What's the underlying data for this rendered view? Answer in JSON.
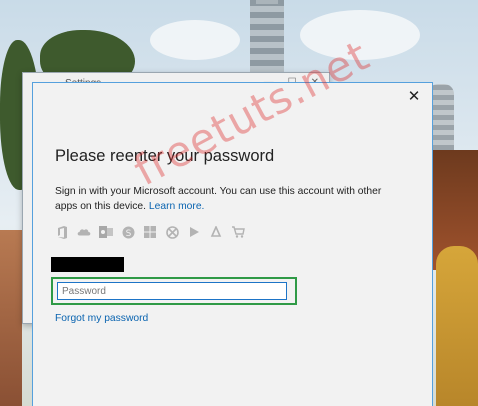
{
  "back_window": {
    "title": "Settings",
    "back_symbol": "←",
    "controls": [
      "—",
      "☐",
      "✕"
    ]
  },
  "dialog": {
    "close_symbol": "✕",
    "title": "Please reenter your password",
    "description": "Sign in with your Microsoft account. You can use this account with other apps on this device.",
    "learn_more": "Learn more.",
    "app_icons": [
      "office-icon",
      "onedrive-icon",
      "outlook-icon",
      "skype-icon",
      "windows-icon",
      "xbox-icon",
      "video-icon",
      "music-icon",
      "store-icon"
    ],
    "password": {
      "placeholder": "Password",
      "value": ""
    },
    "forgot_link": "Forgot my password"
  },
  "watermark": "freetuts.net",
  "colors": {
    "link": "#0a64b0",
    "highlight": "#2f9a46",
    "input_border": "#1d74c7",
    "dialog_border": "#55a0dd"
  }
}
